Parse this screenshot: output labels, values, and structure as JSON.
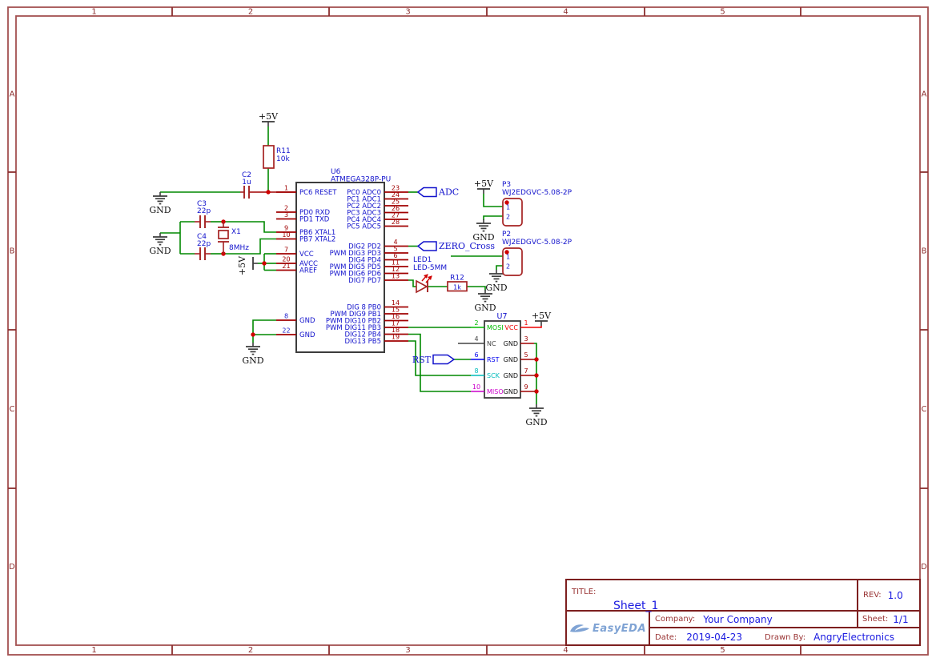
{
  "colors": {
    "wire": "#008800",
    "pin": "#A00000",
    "component": "#A52222",
    "junction": "#D00000",
    "label_blue": "#1212CC",
    "symbol": "#3C3C3C",
    "text_black": "#111111",
    "frame": "#A35050",
    "frame_text": "#8B2E2E",
    "accent_red": "#EE0000",
    "led_arrow": "#D00000"
  },
  "frame": {
    "columns": [
      "1",
      "2",
      "3",
      "4",
      "5"
    ],
    "rows": [
      "A",
      "B",
      "C",
      "D"
    ]
  },
  "power": {
    "v5": "+5V",
    "gnd": "GND"
  },
  "net_flags": {
    "adc": "ADC",
    "zero_cross": "ZERO_Cross",
    "rst": "RST"
  },
  "components": {
    "r11": {
      "ref": "R11",
      "value": "10k"
    },
    "c2": {
      "ref": "C2",
      "value": "1u"
    },
    "c3": {
      "ref": "C3",
      "value": "22p"
    },
    "c4": {
      "ref": "C4",
      "value": "22p"
    },
    "x1": {
      "ref": "X1",
      "value": "8MHz"
    },
    "led1": {
      "ref": "LED1",
      "value": "LED-5MM"
    },
    "r12": {
      "ref": "R12",
      "value": "1k"
    },
    "p3": {
      "ref": "P3",
      "value": "WJ2EDGVC-5.08-2P",
      "pins": [
        "1",
        "2"
      ]
    },
    "p2": {
      "ref": "P2",
      "value": "WJ2EDGVC-5.08-2P",
      "pins": [
        "1",
        "2"
      ]
    },
    "u6": {
      "ref": "U6",
      "value": "ATMEGA328P-PU",
      "left_pins": [
        {
          "num": "1",
          "name": "PC6 RESET"
        },
        {
          "num": "2",
          "name": "PD0 RXD"
        },
        {
          "num": "3",
          "name": "PD1 TXD"
        },
        {
          "num": "9",
          "name": "PB6 XTAL1"
        },
        {
          "num": "10",
          "name": "PB7 XTAL2"
        },
        {
          "num": "7",
          "name": "VCC"
        },
        {
          "num": "20",
          "name": "AVCC"
        },
        {
          "num": "21",
          "name": "AREF"
        },
        {
          "num": "8",
          "name": "GND",
          "num_color": "#2222CC"
        },
        {
          "num": "22",
          "name": "GND",
          "num_color": "#2222CC"
        }
      ],
      "right_pins": [
        {
          "num": "23",
          "name": "PC0 ADC0"
        },
        {
          "num": "24",
          "name": "PC1 ADC1"
        },
        {
          "num": "25",
          "name": "PC2 ADC2"
        },
        {
          "num": "26",
          "name": "PC3 ADC3"
        },
        {
          "num": "27",
          "name": "PC4 ADC4"
        },
        {
          "num": "28",
          "name": "PC5 ADC5"
        },
        {
          "num": "4",
          "name": "DIG2 PD2"
        },
        {
          "num": "5",
          "name": "PWM DIG3 PD3"
        },
        {
          "num": "6",
          "name": "DIG4 PD4"
        },
        {
          "num": "11",
          "name": "PWM DIG5 PD5"
        },
        {
          "num": "12",
          "name": "PWM DIG6 PD6"
        },
        {
          "num": "13",
          "name": "DIG7 PD7"
        },
        {
          "num": "14",
          "name": "DIG 8 PB0"
        },
        {
          "num": "15",
          "name": "PWM DIG9 PB1"
        },
        {
          "num": "16",
          "name": "PWM DIG10 PB2"
        },
        {
          "num": "17",
          "name": "PWM DIG11 PB3"
        },
        {
          "num": "18",
          "name": "DIG12 PB4"
        },
        {
          "num": "19",
          "name": "DIG13 PB5"
        }
      ]
    },
    "u7": {
      "ref": "U7",
      "left_pins": [
        {
          "num": "2",
          "name": "MOSI",
          "color": "#00BB00"
        },
        {
          "num": "4",
          "name": "NC",
          "color": "#444444"
        },
        {
          "num": "6",
          "name": "RST",
          "color": "#0000EE"
        },
        {
          "num": "8",
          "name": "SCK",
          "color": "#00BBBB"
        },
        {
          "num": "10",
          "name": "MISO",
          "color": "#CC00CC"
        }
      ],
      "right_pins": [
        {
          "num": "1",
          "name": "VCC",
          "color": "#EE0000"
        },
        {
          "num": "3",
          "name": "GND",
          "color": "#111111"
        },
        {
          "num": "5",
          "name": "GND",
          "color": "#111111"
        },
        {
          "num": "7",
          "name": "GND",
          "color": "#111111"
        },
        {
          "num": "9",
          "name": "GND",
          "color": "#111111"
        }
      ]
    }
  },
  "title_block": {
    "title_label": "TITLE:",
    "title": "Sheet_1",
    "rev_label": "REV:",
    "rev": "1.0",
    "logo_text": "EasyEDA",
    "company_label": "Company:",
    "company": "Your Company",
    "sheet_label": "Sheet:",
    "sheet": "1/1",
    "date_label": "Date:",
    "date": "2019-04-23",
    "drawn_by_label": "Drawn By:",
    "drawn_by": "AngryElectronics"
  }
}
